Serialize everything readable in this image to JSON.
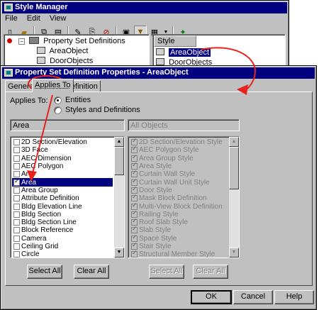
{
  "style_manager": {
    "title": "Style Manager",
    "menu": [
      "File",
      "Edit",
      "View"
    ],
    "toolbar_icons": [
      "new-icon",
      "open-icon",
      "copy-icon",
      "paste-icon",
      "edit-icon",
      "purge-icon",
      "filter-icon",
      "grid-icon",
      "display-icon"
    ],
    "tree": {
      "root_label": "Property Set Definitions",
      "items": [
        "AreaObject",
        "DoorObjects"
      ]
    },
    "list_header": "Style",
    "list_items": [
      "AreaObject",
      "DoorObjects"
    ]
  },
  "dialog": {
    "title": "Property Set Definition Properties - AreaObject",
    "tabs": [
      "General",
      "Applies To",
      "Definition"
    ],
    "active_tab": "Applies To",
    "applies_to_label": "Applies To:",
    "radio_entities": "Entities",
    "radio_styles": "Styles and Definitions",
    "left_field_value": "Area",
    "right_field_value": "All Objects",
    "left_items": [
      {
        "label": "2D Section/Elevation",
        "checked": false
      },
      {
        "label": "3D Face",
        "checked": false
      },
      {
        "label": "AEC Dimension",
        "checked": false
      },
      {
        "label": "AEC Polygon",
        "checked": false
      },
      {
        "label": "Arc",
        "checked": false
      },
      {
        "label": "Area",
        "checked": true
      },
      {
        "label": "Area Group",
        "checked": false
      },
      {
        "label": "Attribute Definition",
        "checked": false
      },
      {
        "label": "Bldg Elevation Line",
        "checked": false
      },
      {
        "label": "Bldg Section",
        "checked": false
      },
      {
        "label": "Bldg Section Line",
        "checked": false
      },
      {
        "label": "Block Reference",
        "checked": false
      },
      {
        "label": "Camera",
        "checked": false
      },
      {
        "label": "Ceiling Grid",
        "checked": false
      },
      {
        "label": "Circle",
        "checked": false
      }
    ],
    "right_items": [
      {
        "label": "2D Section/Elevation Style",
        "checked": true
      },
      {
        "label": "AEC Polygon Style",
        "checked": true
      },
      {
        "label": "Area Group Style",
        "checked": true
      },
      {
        "label": "Area Style",
        "checked": true
      },
      {
        "label": "Curtain Wall Style",
        "checked": true
      },
      {
        "label": "Curtain Wall Unit Style",
        "checked": true
      },
      {
        "label": "Door Style",
        "checked": true
      },
      {
        "label": "Mask Block Definition",
        "checked": true
      },
      {
        "label": "Multi-View Block Definition",
        "checked": true
      },
      {
        "label": "Railing Style",
        "checked": true
      },
      {
        "label": "Roof Slab Style",
        "checked": true
      },
      {
        "label": "Slab Style",
        "checked": true
      },
      {
        "label": "Space Style",
        "checked": true
      },
      {
        "label": "Stair Style",
        "checked": true
      },
      {
        "label": "Structural Member Style",
        "checked": true
      }
    ],
    "select_all": "Select All",
    "clear_all": "Clear All",
    "ok": "OK",
    "cancel": "Cancel",
    "help": "Help",
    "annotation_color": "#e8231f"
  }
}
